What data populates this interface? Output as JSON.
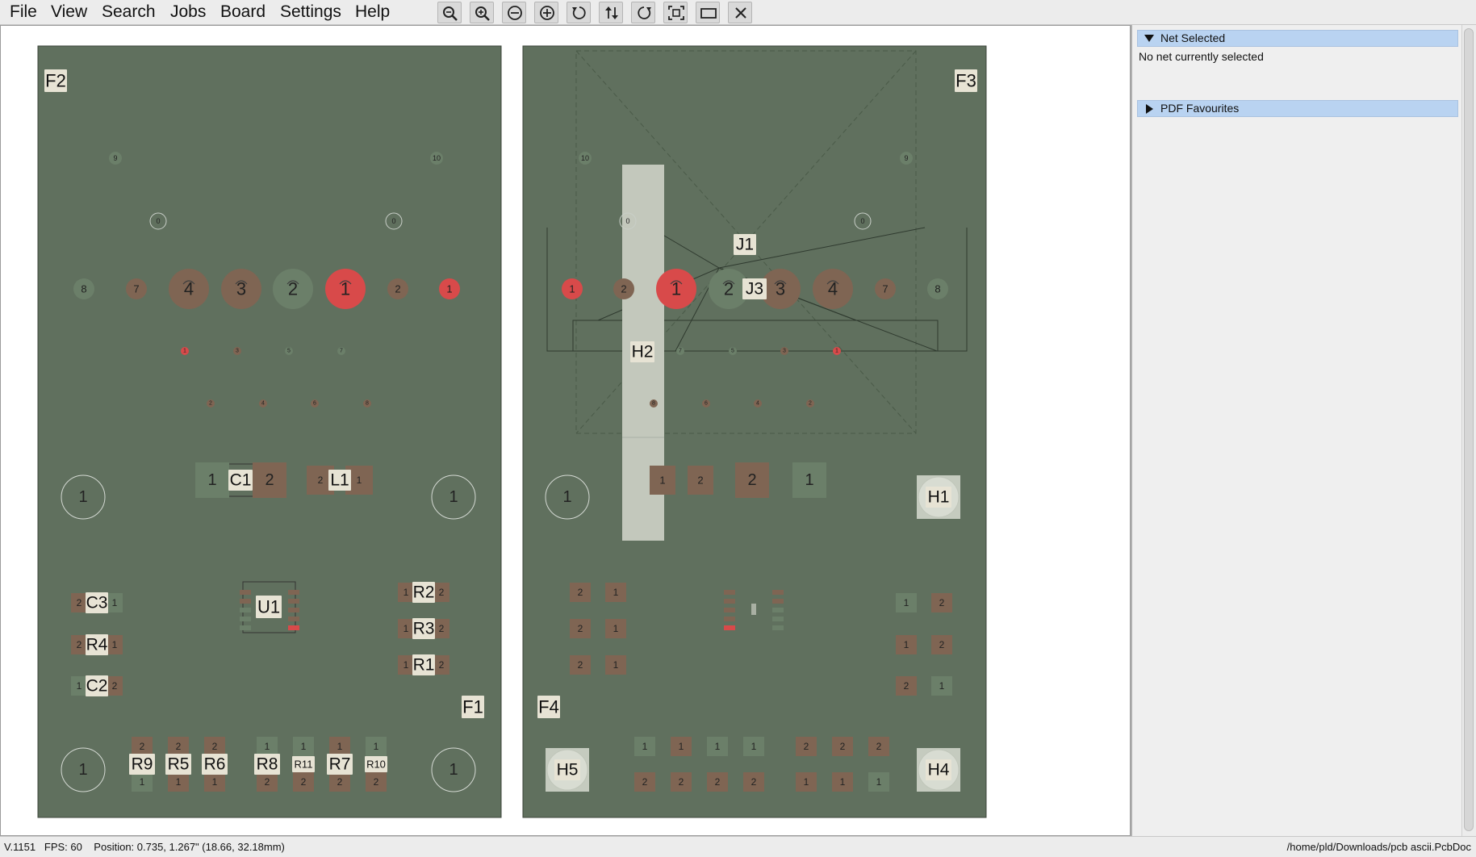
{
  "menu": {
    "file": "File",
    "view": "View",
    "search": "Search",
    "jobs": "Jobs",
    "board": "Board",
    "settings": "Settings",
    "help": "Help"
  },
  "toolbar": {
    "icons": [
      "zoom-out-icon",
      "zoom-in-icon",
      "minus-circle-icon",
      "plus-circle-icon",
      "rotate-ccw-icon",
      "flip-icon",
      "rotate-cw-icon",
      "fit-screen-icon",
      "rectangle-icon",
      "close-icon"
    ]
  },
  "board": {
    "fiducials": {
      "f1": "F1",
      "f2": "F2",
      "f3": "F3",
      "f4": "F4"
    },
    "top_header_pins": [
      "8",
      "7",
      "4",
      "3",
      "2",
      "1",
      "2",
      "1"
    ],
    "bottom_header_pins": [
      "1",
      "2",
      "1",
      "2",
      "3",
      "4",
      "7",
      "8"
    ],
    "top_small_upper": [
      "9",
      "10"
    ],
    "top_small_zero": [
      "0",
      "0"
    ],
    "top_small_odd": [
      "1",
      "3",
      "5",
      "7"
    ],
    "top_small_even": [
      "2",
      "4",
      "6",
      "8"
    ],
    "bottom_small_upper": [
      "10",
      "9"
    ],
    "bottom_small_zero": [
      "0",
      "0"
    ],
    "bottom_small_odd": [
      "7",
      "5",
      "3",
      "1"
    ],
    "bottom_small_even": [
      "8",
      "6",
      "4",
      "2"
    ],
    "mount_hole": "1",
    "refdes": {
      "c1": "C1",
      "l1": "L1",
      "c2": "C2",
      "c3": "C3",
      "r1": "R1",
      "r2": "R2",
      "r3": "R3",
      "r4": "R4",
      "r5": "R5",
      "r6": "R6",
      "r7": "R7",
      "r8": "R8",
      "r9": "R9",
      "r10": "R10",
      "r11": "R11",
      "u1": "U1",
      "j1": "J1",
      "j3": "J3",
      "h1": "H1",
      "h2": "H2",
      "h4": "H4",
      "h5": "H5"
    },
    "pads": {
      "c1": [
        "1",
        "2"
      ],
      "l1": [
        "2",
        "1"
      ],
      "c3": [
        "2",
        "1"
      ],
      "r4": [
        "2",
        "1"
      ],
      "c2": [
        "1",
        "2"
      ],
      "r2": [
        "1",
        "2"
      ],
      "r3": [
        "1",
        "2"
      ],
      "r1": [
        "1",
        "2"
      ],
      "bottom_row_upper": [
        "2",
        "2",
        "2",
        "1",
        "1",
        "1",
        "1"
      ],
      "bottom_row_lower": [
        "1",
        "1",
        "1",
        "2",
        "2",
        "2",
        "2"
      ],
      "b_mid_pads": [
        "1",
        "2",
        "2",
        "1"
      ],
      "b_left_col": [
        "2",
        "1",
        "2",
        "1",
        "2",
        "1"
      ],
      "b_right_col": [
        "1",
        "2",
        "1",
        "2",
        "2",
        "1"
      ],
      "b_row_upper": [
        "1",
        "1",
        "1",
        "1",
        "2",
        "2",
        "2"
      ],
      "b_row_lower": [
        "2",
        "2",
        "2",
        "2",
        "1",
        "1",
        "1"
      ]
    }
  },
  "panel": {
    "net_selected": "Net Selected",
    "no_net": "No net currently selected",
    "pdf_favourites": "PDF Favourites"
  },
  "status": {
    "left": "V.1151   FPS: 60    Position: 0.735, 1.267\" (18.66, 32.18mm)",
    "right": "/home/pld/Downloads/pcb ascii.PcbDoc"
  },
  "colors": {
    "board": "#60705e",
    "pad_copper": "#7f6553",
    "pad_green": "#6b7f69",
    "pad_selected": "#d84a4a",
    "label_bg": "#e7e3d4",
    "panel_header": "#b9d3f1"
  }
}
